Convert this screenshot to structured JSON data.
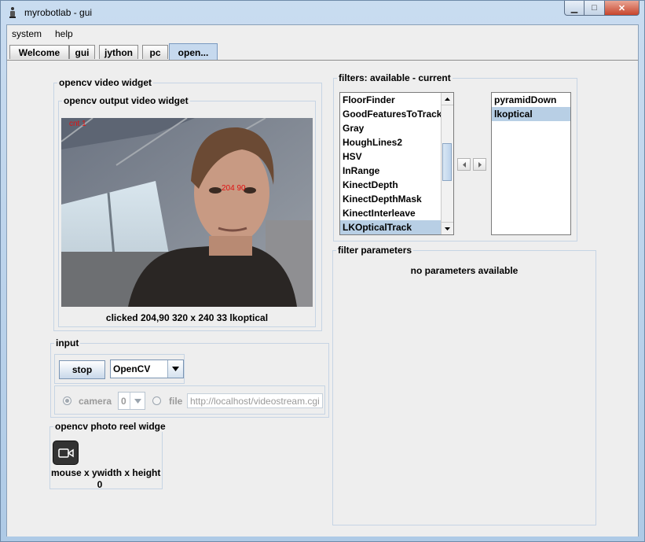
{
  "window": {
    "title": "myrobotlab - gui"
  },
  "menu": [
    "system",
    "help"
  ],
  "tabs": [
    {
      "label": "Welcome"
    },
    {
      "label": "gui"
    },
    {
      "label": "jython"
    },
    {
      "label": "pc"
    },
    {
      "label": "open..."
    }
  ],
  "video_widget": {
    "title": "opencv  video widget",
    "output_title": "opencv output video widget",
    "overlay_top": "cnt 1",
    "overlay_face": "204 90",
    "status": "clicked 204,90  320 x 240  33  lkoptical"
  },
  "input": {
    "title": "input",
    "stop_label": "stop",
    "source": "OpenCV",
    "camera_label": "camera",
    "camera_index": "0",
    "file_label": "file",
    "file_url": "http://localhost/videostream.cgi"
  },
  "photo_reel": {
    "title": "opencv  photo reel widge",
    "caption": "mouse x ywidth x height",
    "value": "0"
  },
  "filters": {
    "title": "filters: available - current",
    "available": [
      "FloorFinder",
      "GoodFeaturesToTrack",
      "Gray",
      "HoughLines2",
      "HSV",
      "InRange",
      "KinectDepth",
      "KinectDepthMask",
      "KinectInterleave",
      "LKOpticalTrack"
    ],
    "current": [
      "pyramidDown",
      "lkoptical"
    ]
  },
  "filter_params": {
    "title": "filter parameters",
    "empty_text": "no parameters available"
  },
  "colors": {
    "accent": "#b8cfe5",
    "overlay_text": "#e01010"
  }
}
